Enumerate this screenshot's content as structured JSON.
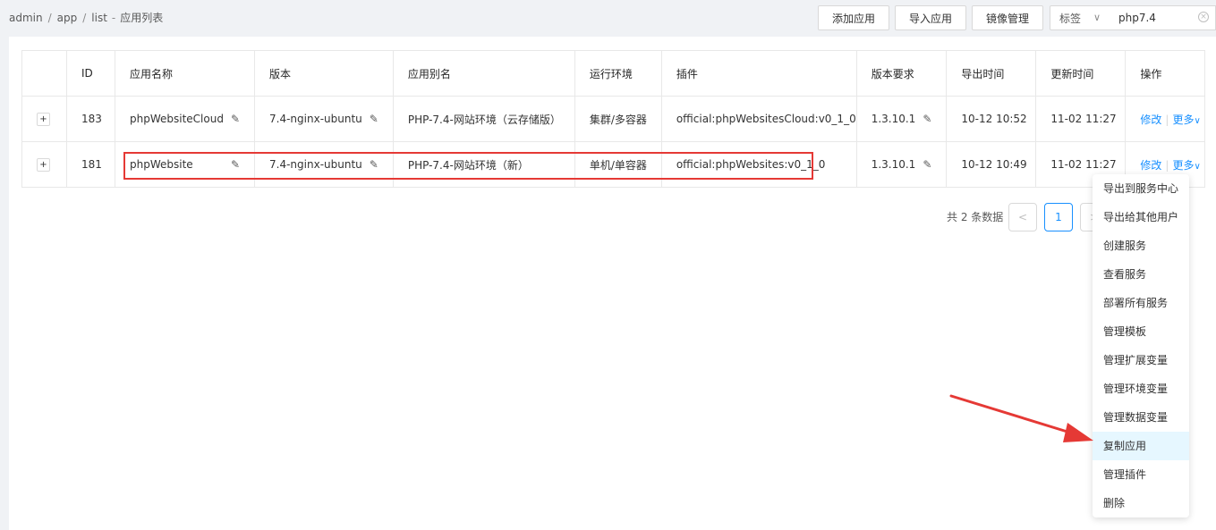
{
  "breadcrumb": {
    "items": [
      "admin",
      "app",
      "list"
    ],
    "current": "应用列表"
  },
  "toolbar": {
    "add_app": "添加应用",
    "import_app": "导入应用",
    "image_mgmt": "镜像管理",
    "tag_label": "标签",
    "search_value": "php7.4"
  },
  "table": {
    "headers": [
      "ID",
      "应用名称",
      "版本",
      "应用别名",
      "运行环境",
      "插件",
      "版本要求",
      "导出时间",
      "更新时间",
      "操作"
    ],
    "rows": [
      {
        "id": "183",
        "name": "phpWebsiteCloud",
        "version": "7.4-nginx-ubuntu",
        "alias": "PHP-7.4-网站环境（云存储版）",
        "env": "集群/多容器",
        "plugin": "official:phpWebsitesCloud:v0_1_0",
        "req": "1.3.10.1",
        "export_time": "10-12 10:52",
        "update_time": "11-02 11:27",
        "edit": "修改",
        "more": "更多"
      },
      {
        "id": "181",
        "name": "phpWebsite",
        "version": "7.4-nginx-ubuntu",
        "alias": "PHP-7.4-网站环境（新）",
        "env": "单机/单容器",
        "plugin": "official:phpWebsites:v0_1_0",
        "req": "1.3.10.1",
        "export_time": "10-12 10:49",
        "update_time": "11-02 11:27",
        "edit": "修改",
        "more": "更多"
      }
    ]
  },
  "pagination": {
    "total": "共 2 条数据",
    "current_page": "1"
  },
  "dropdown": {
    "items": [
      "导出到服务中心",
      "导出给其他用户",
      "创建服务",
      "查看服务",
      "部署所有服务",
      "管理模板",
      "管理扩展变量",
      "管理环境变量",
      "管理数据变量",
      "复制应用",
      "管理插件",
      "删除"
    ],
    "hovered_index": 9
  },
  "colors": {
    "accent": "#1890ff",
    "success": "#52c41a",
    "annotation": "#e53935"
  }
}
